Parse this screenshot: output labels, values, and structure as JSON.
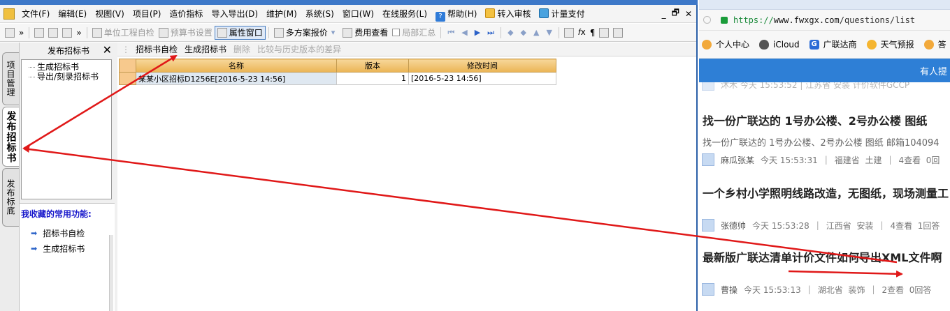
{
  "menubar": {
    "items": [
      "文件(F)",
      "编辑(E)",
      "视图(V)",
      "项目(P)",
      "造价指标",
      "导入导出(D)",
      "维护(M)",
      "系统(S)",
      "窗口(W)",
      "在线服务(L)"
    ],
    "help": "帮助(H)",
    "review": "转入审核",
    "pay": "计量支付",
    "minimize": "_",
    "restore": "🗗",
    "close": "✕"
  },
  "toolbar": {
    "chevron": "»",
    "unit_check": "单位工程自检",
    "budget_settings": "预算书设置",
    "property_window": "属性窗口",
    "multi_scheme": "多方案报价",
    "fee_view": "费用查看",
    "partial_summary": "局部汇总",
    "pilcrow": "¶",
    "fx": "𝑓x"
  },
  "vtabs": {
    "project": "项目管理",
    "publish_tender": "发布招标书",
    "publish_bid": "发布标底"
  },
  "left_panel": {
    "title": "发布招标书",
    "close": "✕",
    "tree": [
      "生成招标书",
      "导出/刻录招标书"
    ],
    "fav_title": "我收藏的常用功能:",
    "fav_items": [
      "招标书自检",
      "生成招标书"
    ]
  },
  "main": {
    "tabs": [
      "招标书自检",
      "生成招标书",
      "删除",
      "比较与历史版本的差异"
    ],
    "grid": {
      "headers": [
        "名称",
        "版本",
        "修改时间"
      ],
      "rows": [
        {
          "name": "某某小区招标D1256E[2016-5-23  14:56]",
          "version": "1",
          "modified": "[2016-5-23  14:56]"
        }
      ]
    }
  },
  "browser": {
    "url_scheme": "https://",
    "url_host": "www.fwxgx.com",
    "url_path": "/questions/list",
    "bookmarks": [
      "个人中心",
      "iCloud",
      "广联达商",
      "天气预报",
      "答"
    ],
    "banner": "有人提",
    "partial_meta": "沐木   今天 15:53:52   |   江苏省  安装  计价软件GCCP",
    "questions": [
      {
        "title": "找一份广联达的 1号办公楼、2号办公楼 图纸",
        "snippet": "找一份广联达的 1号办公楼、2号办公楼 图纸 邮箱104094",
        "user": "麻瓜张某",
        "time": "今天 15:53:31",
        "region": "福建省",
        "category": "土建",
        "views": "4查看",
        "answers": "0回"
      },
      {
        "title": "一个乡村小学照明线路改造，无图纸，现场测量工",
        "snippet": "",
        "user": "张德帅",
        "time": "今天 15:53:28",
        "region": "江西省",
        "category": "安装",
        "views": "4查看",
        "answers": "1回答"
      },
      {
        "title": "最新版广联达清单计价文件如何导出XML文件啊",
        "snippet": "",
        "user": "曹操",
        "time": "今天 15:53:13",
        "region": "湖北省",
        "category": "装饰",
        "views": "2查看",
        "answers": "0回答"
      }
    ]
  },
  "colors": {
    "annotation_arrow": "#e01818",
    "browser_banner": "#2e7fd6",
    "grid_header": "#f0c070"
  }
}
